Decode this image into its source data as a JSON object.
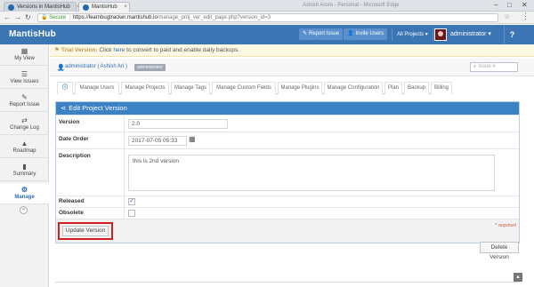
{
  "browser": {
    "tabs": [
      {
        "label": "Versions in MantisHub",
        "close": "×"
      },
      {
        "label": "MantisHub",
        "close": "×"
      }
    ],
    "window_title": "Ashish Arora - Personal - Microsoft Edge",
    "controls": {
      "minimize": "–",
      "maximize": "□",
      "close": "✕"
    },
    "nav": {
      "back": "←",
      "forward": "→",
      "reload": "↻"
    },
    "address": {
      "lock": "🔒",
      "secure_label": "Secure",
      "sep": "|",
      "url_host": "https://learnbugtracker.mantishub.io",
      "url_path": "/manage_proj_ver_edit_page.php?version_id=3"
    },
    "star": "☆",
    "menu": "⋮"
  },
  "navbar": {
    "brand": "MantisHub",
    "report_issue": "Report Issue",
    "invite_users": "Invite Users",
    "project_selector": "All Projects",
    "username": "administrator",
    "help": "?",
    "caret": "▾",
    "report_icon": "✎",
    "invite_icon": "👤"
  },
  "sidebar": {
    "items": [
      {
        "label": "My View",
        "icon": "▦"
      },
      {
        "label": "View Issues",
        "icon": "☰"
      },
      {
        "label": "Report Issue",
        "icon": "✎"
      },
      {
        "label": "Change Log",
        "icon": "⇄"
      },
      {
        "label": "Roadmap",
        "icon": "▲"
      },
      {
        "label": "Summary",
        "icon": "▮"
      },
      {
        "label": "Manage",
        "icon": "⚙"
      }
    ],
    "collapse": "«"
  },
  "trial": {
    "flag": "⚑",
    "label": "Trial Version:",
    "pre": " Click ",
    "link": "here",
    "post": " to convert to paid and enable daily backups."
  },
  "breadcrumb": {
    "user_icon": "👤",
    "user": "administrator ( Ashish Ari )",
    "role": "administrator",
    "search_placeholder": "Issue #",
    "search_icon": "⌕"
  },
  "manage_tabs": [
    {
      "label": "ⓘ"
    },
    {
      "label": "Manage Users"
    },
    {
      "label": "Manage Projects"
    },
    {
      "label": "Manage Tags"
    },
    {
      "label": "Manage Custom Fields"
    },
    {
      "label": "Manage Plugins"
    },
    {
      "label": "Manage Configuration"
    },
    {
      "label": "Plan"
    },
    {
      "label": "Backup"
    },
    {
      "label": "Billing"
    }
  ],
  "form": {
    "title": "Edit Project Version",
    "title_icon": "⋖",
    "version_label": "Version",
    "version_value": "2.0",
    "date_label": "Date Order",
    "date_value": "2017-07-05 05:33",
    "calendar_icon": "▦",
    "description_label": "Description",
    "description_value": "this is 2nd version",
    "released_label": "Released",
    "released_checked": true,
    "released_mark": "✓",
    "obsolete_label": "Obsolete",
    "obsolete_checked": false,
    "update_button": "Update Version",
    "required_note": "* required"
  },
  "delete_button": "Delete Version",
  "scroll_top": "▲"
}
